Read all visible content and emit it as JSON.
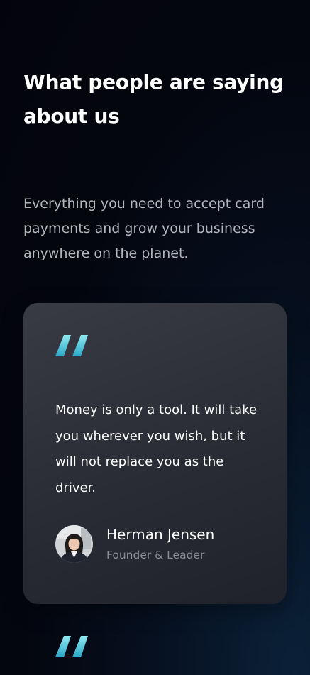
{
  "section": {
    "title": "What people are saying about us",
    "subtitle": "Everything you need to accept card payments and grow your business anywhere on the planet."
  },
  "testimonials": [
    {
      "quote": "Money is only a tool. It will take you wherever you wish, but it will not replace you as the driver.",
      "author_name": "Herman Jensen",
      "author_role": "Founder & Leader",
      "avatar": "person-photo"
    }
  ],
  "icons": {
    "quote": "quote-mark-icon"
  },
  "colors": {
    "background": "#03040b",
    "card": "#2e3039",
    "accent_light": "#8fe9f0",
    "accent_dark": "#2aa7c7",
    "muted_text": "#b4b6bf",
    "role_text": "#8a8c94"
  }
}
